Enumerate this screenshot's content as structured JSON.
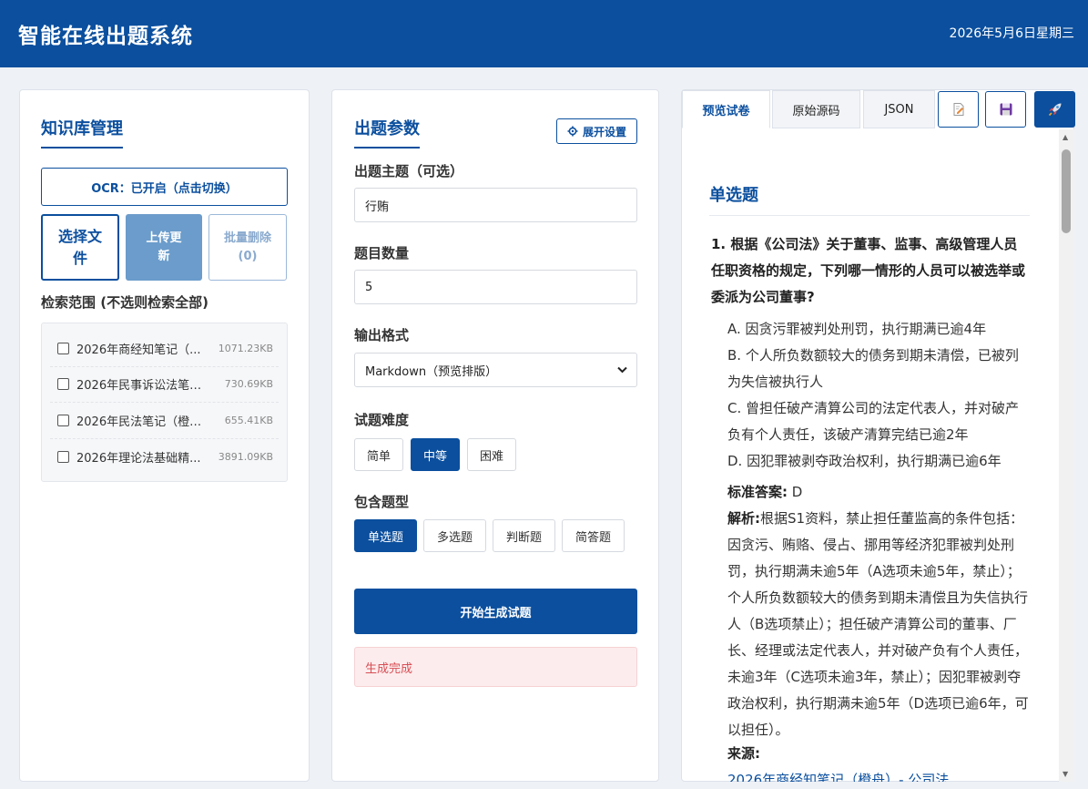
{
  "header": {
    "title": "智能在线出题系统",
    "date": "2026年5月6日星期三"
  },
  "kb": {
    "title": "知识库管理",
    "ocr_button": "OCR：已开启（点击切换）",
    "select_file": "选择文件",
    "upload": "上传更新",
    "batch_delete": "批量删除(0)",
    "scope_label": "检索范围 (不选则检索全部)",
    "files": [
      {
        "name": "2026年商经知笔记（...",
        "size": "1071.23KB"
      },
      {
        "name": "2026年民事诉讼法笔记...",
        "size": "730.69KB"
      },
      {
        "name": "2026年民法笔记（橙舟...",
        "size": "655.41KB"
      },
      {
        "name": "2026年理论法基础精...",
        "size": "3891.09KB"
      }
    ]
  },
  "params": {
    "title": "出题参数",
    "expand": "展开设置",
    "topic_label": "出题主题（可选）",
    "topic_value": "行贿",
    "count_label": "题目数量",
    "count_value": "5",
    "format_label": "输出格式",
    "format_value": "Markdown（预览排版）",
    "difficulty_label": "试题难度",
    "difficulty": [
      "简单",
      "中等",
      "困难"
    ],
    "difficulty_selected": "中等",
    "types_label": "包含题型",
    "types": [
      "单选题",
      "多选题",
      "判断题",
      "简答题"
    ],
    "types_selected": [
      "单选题"
    ],
    "generate": "开始生成试题",
    "status": "生成完成"
  },
  "preview": {
    "tabs": [
      "预览试卷",
      "原始源码",
      "JSON"
    ],
    "active_tab": "预览试卷",
    "tools": [
      "edit-icon",
      "save-icon",
      "rocket-icon"
    ],
    "section": "单选题",
    "question": "1. 根据《公司法》关于董事、监事、高级管理人员任职资格的规定，下列哪一情形的人员可以被选举或委派为公司董事?",
    "options": [
      "A. 因贪污罪被判处刑罚，执行期满已逾4年",
      "B. 个人所负数额较大的债务到期未清偿，已被列为失信被执行人",
      "C. 曾担任破产清算公司的法定代表人，并对破产负有个人责任，该破产清算完结已逾2年",
      "D. 因犯罪被剥夺政治权利，执行期满已逾6年"
    ],
    "answer_label": "标准答案:",
    "answer": "D",
    "analysis_label": "解析:",
    "analysis": "根据S1资料，禁止担任董监高的条件包括：因贪污、贿赂、侵占、挪用等经济犯罪被判处刑罚，执行期满未逾5年（A选项未逾5年，禁止）；个人所负数额较大的债务到期未清偿且为失信执行人（B选项禁止）；担任破产清算公司的董事、厂长、经理或法定代表人，并对破产负有个人责任，未逾3年（C选项未逾3年，禁止）；因犯罪被剥夺政治权利，执行期满未逾5年（D选项已逾6年，可以担任）。",
    "source_label": "来源:",
    "source_partial": "2026年商经知笔记（橙舟）- 公司法"
  },
  "colors": {
    "primary": "#0b4f9e",
    "status_bg": "#fdeced",
    "status_text": "#d64f55"
  }
}
